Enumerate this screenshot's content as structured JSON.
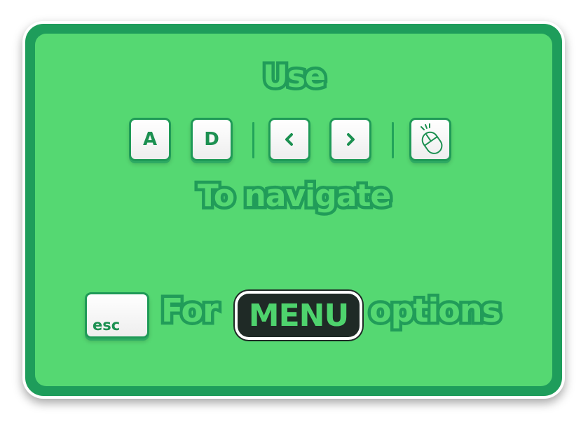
{
  "tutorial": {
    "heading_use": "Use",
    "heading_navigate": "To navigate",
    "keys": {
      "a": "A",
      "d": "D",
      "left_arrow_icon": "chevron-left-icon",
      "right_arrow_icon": "chevron-right-icon",
      "mouse_icon": "mouse-click-icon"
    },
    "menu_hint": {
      "esc_key": "esc",
      "for_text": "For",
      "menu_text": "MENU",
      "options_text": "options"
    }
  },
  "colors": {
    "panel_green": "#55d872",
    "frame_green": "#1e9d5b",
    "outline_green": "#219c59",
    "key_text": "#1c9051",
    "menu_bg": "#1f2a26"
  }
}
